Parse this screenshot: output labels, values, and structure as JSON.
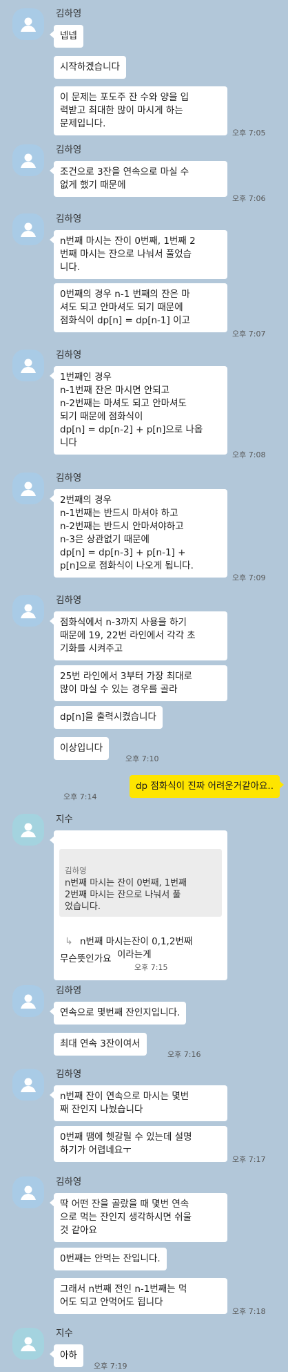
{
  "groups": [
    {
      "sender": "김하영",
      "messages": [
        "넵넵",
        "시작하겠습니다",
        "이 문제는 포도주 잔 수와 양을 입\n력받고 최대한 많이 마시게 하는\n문제입니다."
      ],
      "time": "오후 7:05"
    },
    {
      "sender": "김하영",
      "messages": [
        "조건으로 3잔을 연속으로 마실 수\n없게 했기 때문에"
      ],
      "time": "오후 7:06"
    },
    {
      "sender": "김하영",
      "messages": [
        "n번째 마시는 잔이 0번째, 1번째 2\n번째 마시는 잔으로 나눠서 풀었습\n니다.",
        "0번째의 경우 n-1 번째의 잔은 마\n셔도 되고 안마셔도 되기 때문에\n점화식이 dp[n] = dp[n-1] 이고"
      ],
      "time": "오후 7:07"
    },
    {
      "sender": "김하영",
      "messages": [
        "1번째인 경우\nn-1번째 잔은 마시면 안되고\nn-2번째는 마셔도 되고 안마셔도\n되기 때문에 점화식이\ndp[n] = dp[n-2] + p[n]으로 나옵\n니다"
      ],
      "time": "오후 7:08"
    },
    {
      "sender": "김하영",
      "messages": [
        "2번째의 경우\nn-1번째는 반드시 마셔야 하고\nn-2번째는 반드시 안마셔야하고\nn-3은 상관없기 때문에\ndp[n] = dp[n-3] + p[n-1] +\np[n]으로 점화식이 나오게 됩니다."
      ],
      "time": "오후 7:09"
    },
    {
      "sender": "김하영",
      "messages": [
        "점화식에서 n-3까지 사용을 하기\n때문에 19, 22번 라인에서 각각 초\n기화를 시켜주고",
        "25번 라인에서 3부터 가장 최대로\n많이 마실 수 있는 경우를 골라",
        "dp[n]을 출력시켰습니다",
        "이상입니다"
      ],
      "time": "오후 7:10"
    },
    {
      "mine": "dp 점화식이 진짜 어려운거같아요..",
      "time": "오후 7:14"
    },
    {
      "sender": "지수",
      "quote_name": "김하영",
      "quote_text": "n번째 마시는 잔이 0번째, 1번째\n 2번째 마시는 잔으로 나눠서 풀\n었습니다.",
      "reply": "n번째 마시는잔이 0,1,2번째\n마시는 잔이라는게",
      "messages": [
        "무슨뜻인가요"
      ],
      "time": "오후 7:15"
    },
    {
      "sender": "김하영",
      "messages": [
        "연속으로 몇번째 잔인지입니다.",
        "최대 연속 3잔이여서"
      ],
      "time": "오후 7:16"
    },
    {
      "sender": "김하영",
      "messages": [
        "n번째 잔이 연속으로 마시는 몇번\n째 잔인지 나눴습니다",
        "0번째 땜에 헷갈릴 수 있는데 설명\n하기가 어렵네요ㅜ"
      ],
      "time": "오후 7:17"
    },
    {
      "sender": "김하영",
      "messages": [
        "딱 어떤 잔을 골랐을 때 몇번 연속\n으로 먹는 잔인지 생각하시면 쉬울\n 것 같아요",
        "0번째는 안먹는 잔입니다.",
        "그래서 n번째 전인 n-1번째는 먹\n어도 되고 안먹어도 됩니다"
      ],
      "time": "오후 7:18"
    },
    {
      "sender": "지수",
      "messages": [
        "아하"
      ],
      "time": "오후 7:19"
    }
  ],
  "colors": {
    "background": "#b2c7d9",
    "incoming_bubble": "#ffffff",
    "outgoing_bubble": "#fee500"
  },
  "icons": {
    "avatar": "default-profile-icon"
  }
}
